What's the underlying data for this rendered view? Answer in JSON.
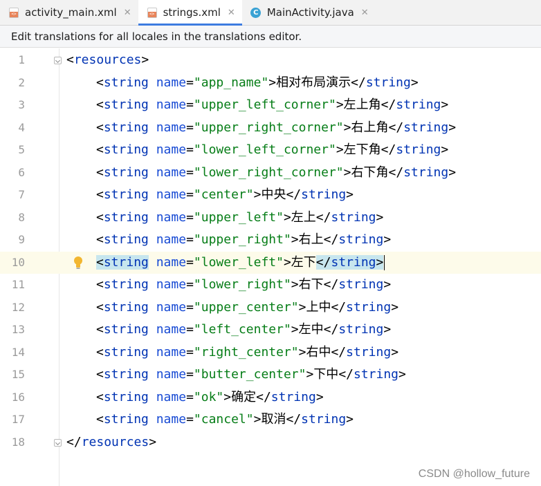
{
  "tabs": [
    {
      "label": "activity_main.xml",
      "icon": "xml-file-icon",
      "active": false
    },
    {
      "label": "strings.xml",
      "icon": "xml-file-icon",
      "active": true
    },
    {
      "label": "MainActivity.java",
      "icon": "java-class-icon",
      "active": false
    }
  ],
  "banner": {
    "text": "Edit translations for all locales in the translations editor."
  },
  "editor": {
    "current_line": 10,
    "lines": [
      {
        "num": "1",
        "open": "<resources>"
      },
      {
        "num": "2",
        "name": "\"app_name\"",
        "value": "相对布局演示"
      },
      {
        "num": "3",
        "name": "\"upper_left_corner\"",
        "value": "左上角"
      },
      {
        "num": "4",
        "name": "\"upper_right_corner\"",
        "value": "右上角"
      },
      {
        "num": "5",
        "name": "\"lower_left_corner\"",
        "value": "左下角"
      },
      {
        "num": "6",
        "name": "\"lower_right_corner\"",
        "value": "右下角"
      },
      {
        "num": "7",
        "name": "\"center\"",
        "value": "中央"
      },
      {
        "num": "8",
        "name": "\"upper_left\"",
        "value": "左上"
      },
      {
        "num": "9",
        "name": "\"upper_right\"",
        "value": "右上"
      },
      {
        "num": "10",
        "name": "\"lower_left\"",
        "value": "左下"
      },
      {
        "num": "11",
        "name": "\"lower_right\"",
        "value": "右下"
      },
      {
        "num": "12",
        "name": "\"upper_center\"",
        "value": "上中"
      },
      {
        "num": "13",
        "name": "\"left_center\"",
        "value": "左中"
      },
      {
        "num": "14",
        "name": "\"right_center\"",
        "value": "右中"
      },
      {
        "num": "15",
        "name": "\"butter_center\"",
        "value": "下中"
      },
      {
        "num": "16",
        "name": "\"ok\"",
        "value": "确定"
      },
      {
        "num": "17",
        "name": "\"cancel\"",
        "value": "取消"
      },
      {
        "num": "18",
        "close": "</resources>"
      }
    ],
    "tokens": {
      "open_tag": "<string",
      "attr": " name=",
      "gt": ">",
      "close_tag": "</string>",
      "close_tag_open": "</string",
      "tag_close_bracket": ">"
    }
  },
  "colors": {
    "tag": "#0033b3",
    "attr": "#174ad4",
    "value": "#067d17",
    "current_line": "#fdfbea",
    "tab_accent": "#3d7ce0"
  },
  "watermark": "CSDN @hollow_future"
}
